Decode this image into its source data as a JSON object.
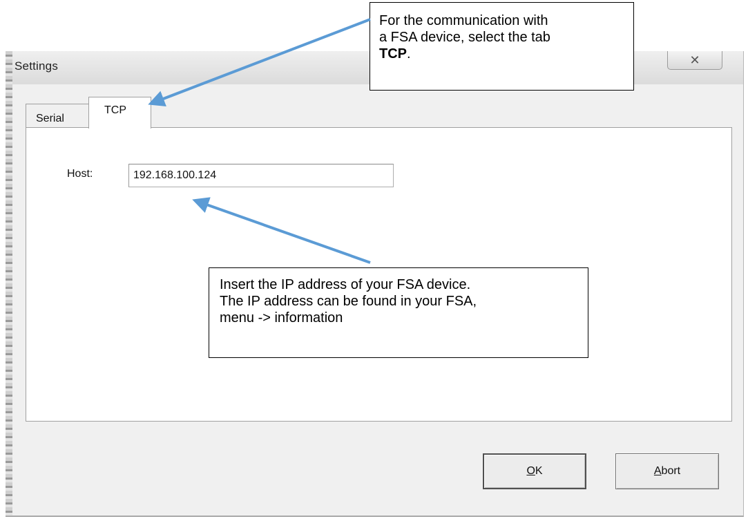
{
  "window": {
    "title": "Settings",
    "close_glyph": "✕"
  },
  "tabs": [
    {
      "label": "Serial",
      "selected": false
    },
    {
      "label": "TCP",
      "selected": true
    }
  ],
  "host": {
    "label": "Host:",
    "value": "192.168.100.124"
  },
  "buttons": {
    "ok": {
      "mnemonic": "O",
      "rest": "K"
    },
    "abort": {
      "mnemonic": "A",
      "rest": "bort"
    }
  },
  "annotations": {
    "tcp_callout": {
      "line1": "For the communication with",
      "line2": "a FSA device, select the tab",
      "bold": "TCP",
      "suffix": "."
    },
    "ip_callout": {
      "line1": "Insert the IP address of your FSA device.",
      "line2": "The IP address can be found in your FSA,",
      "line3": "menu -> information"
    },
    "arrow_color": "#5b9bd5"
  }
}
